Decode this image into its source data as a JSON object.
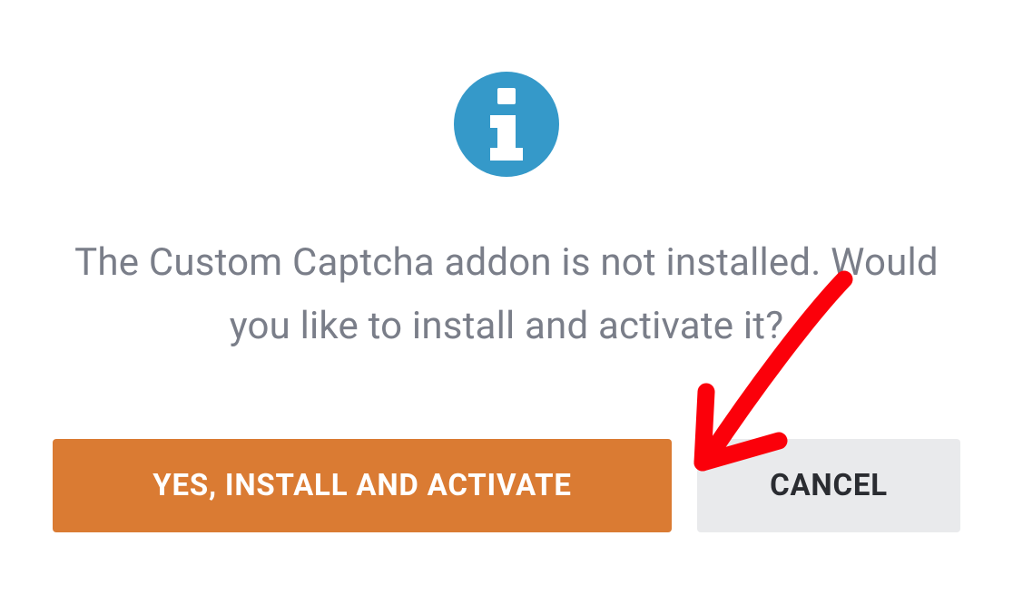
{
  "dialog": {
    "message": "The Custom Captcha addon is not installed. Would you like to install and activate it?",
    "confirm_label": "YES, INSTALL AND ACTIVATE",
    "cancel_label": "CANCEL"
  },
  "colors": {
    "icon_bg": "#3599c9",
    "primary_button": "#da7b33",
    "secondary_button": "#e9eaec",
    "text": "#7a7e89",
    "annotation": "#fb000a"
  }
}
